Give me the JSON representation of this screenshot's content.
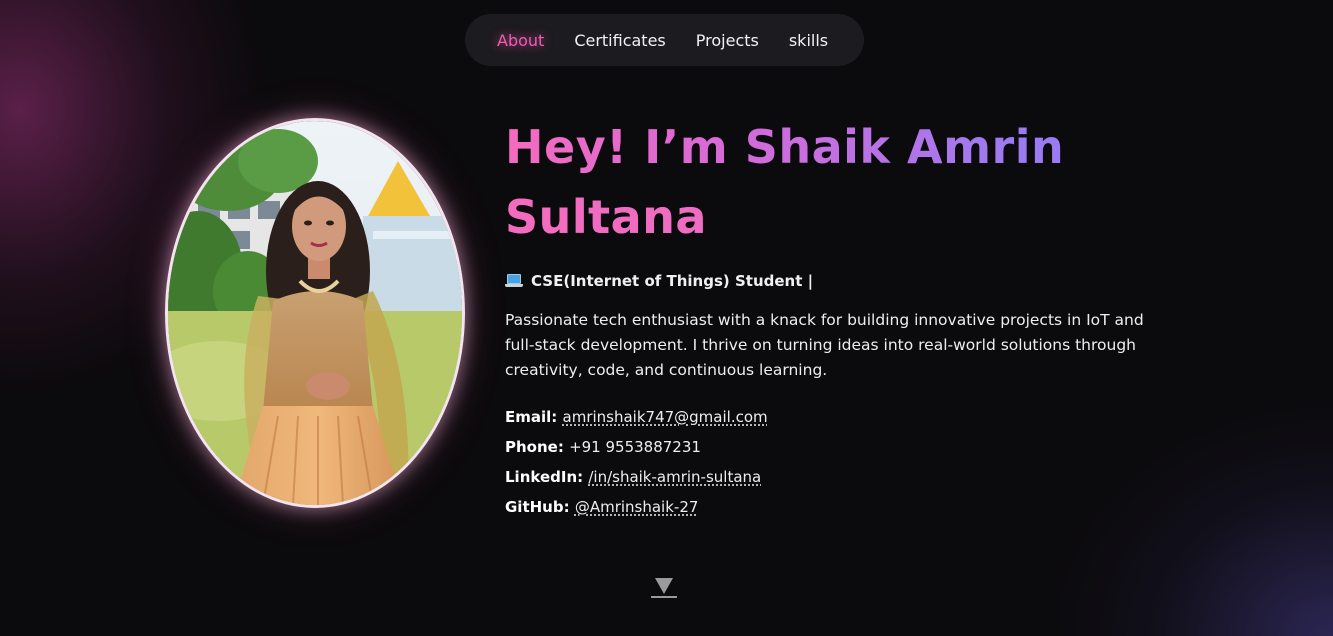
{
  "nav": {
    "items": [
      {
        "label": "About",
        "active": true
      },
      {
        "label": "Certificates",
        "active": false
      },
      {
        "label": "Projects",
        "active": false
      },
      {
        "label": "skills",
        "active": false
      }
    ]
  },
  "hero": {
    "headline_line1": "Hey! I’m Shaik Amrin",
    "headline_line2": "Sultana",
    "role_icon": "laptop-icon",
    "role": "CSE(Internet of Things) Student |",
    "bio": "Passionate tech enthusiast with a knack for building innovative projects in IoT and full-stack development. I thrive on turning ideas into real-world solutions through creativity, code, and continuous learning."
  },
  "contact": {
    "email_label": "Email:",
    "email": "amrinshaik747@gmail.com",
    "phone_label": "Phone:",
    "phone": "+91 9553887231",
    "linkedin_label": "LinkedIn:",
    "linkedin": "/in/shaik-amrin-sultana",
    "github_label": "GitHub:",
    "github": "@Amrinshaik-27"
  },
  "scroll": {
    "icon": "down-arrow-icon"
  },
  "colors": {
    "accent_pink": "#f25ab4",
    "accent_purple": "#9a7bf2",
    "background": "#0b0a0c",
    "nav_bg": "#1c1b1f"
  }
}
